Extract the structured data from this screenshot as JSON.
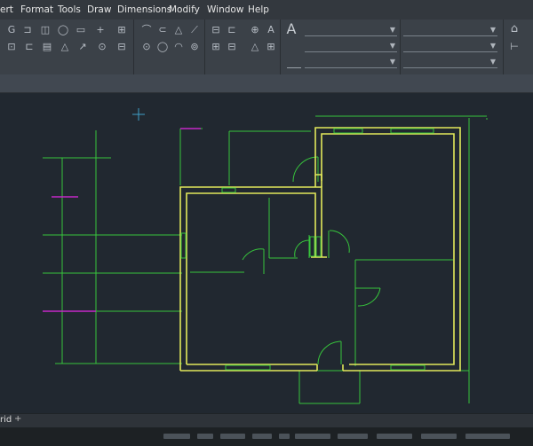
{
  "menu": [
    "ert",
    "Format",
    "Tools",
    "Draw",
    "Dimensions",
    "Modify",
    "Window",
    "Help"
  ],
  "icons": {
    "toolbar_row1": [
      "arc-icon",
      "copy-icon",
      "trim-icon",
      "circle-icon",
      "rectangle-icon",
      "move-icon",
      "scale-icon",
      "table-icon"
    ],
    "toolbar_row2": [
      "block-icon",
      "region-icon",
      "hatch-icon",
      "warning-icon",
      "arrow-icon",
      "insert-icon",
      "measure-icon",
      "layer-icon"
    ],
    "draw_row1": [
      "polyline-icon",
      "line-icon",
      "triangle-icon",
      "spline-icon"
    ],
    "draw_row2": [
      "point-icon",
      "ellipse-icon",
      "multiline-icon",
      "gradient-icon"
    ],
    "annotate": [
      "dimension-icon",
      "text-style-icon",
      "markup-icon",
      "text-icon"
    ],
    "text_tool": "text-A-icon"
  },
  "colors": {
    "wall": "#e2e85a",
    "construction": "#37c53c",
    "magenta": "#c528c8",
    "cursor": "#3fa0c8",
    "canvas": "#212830"
  },
  "tabs": {
    "model": "rid",
    "add": "+"
  }
}
